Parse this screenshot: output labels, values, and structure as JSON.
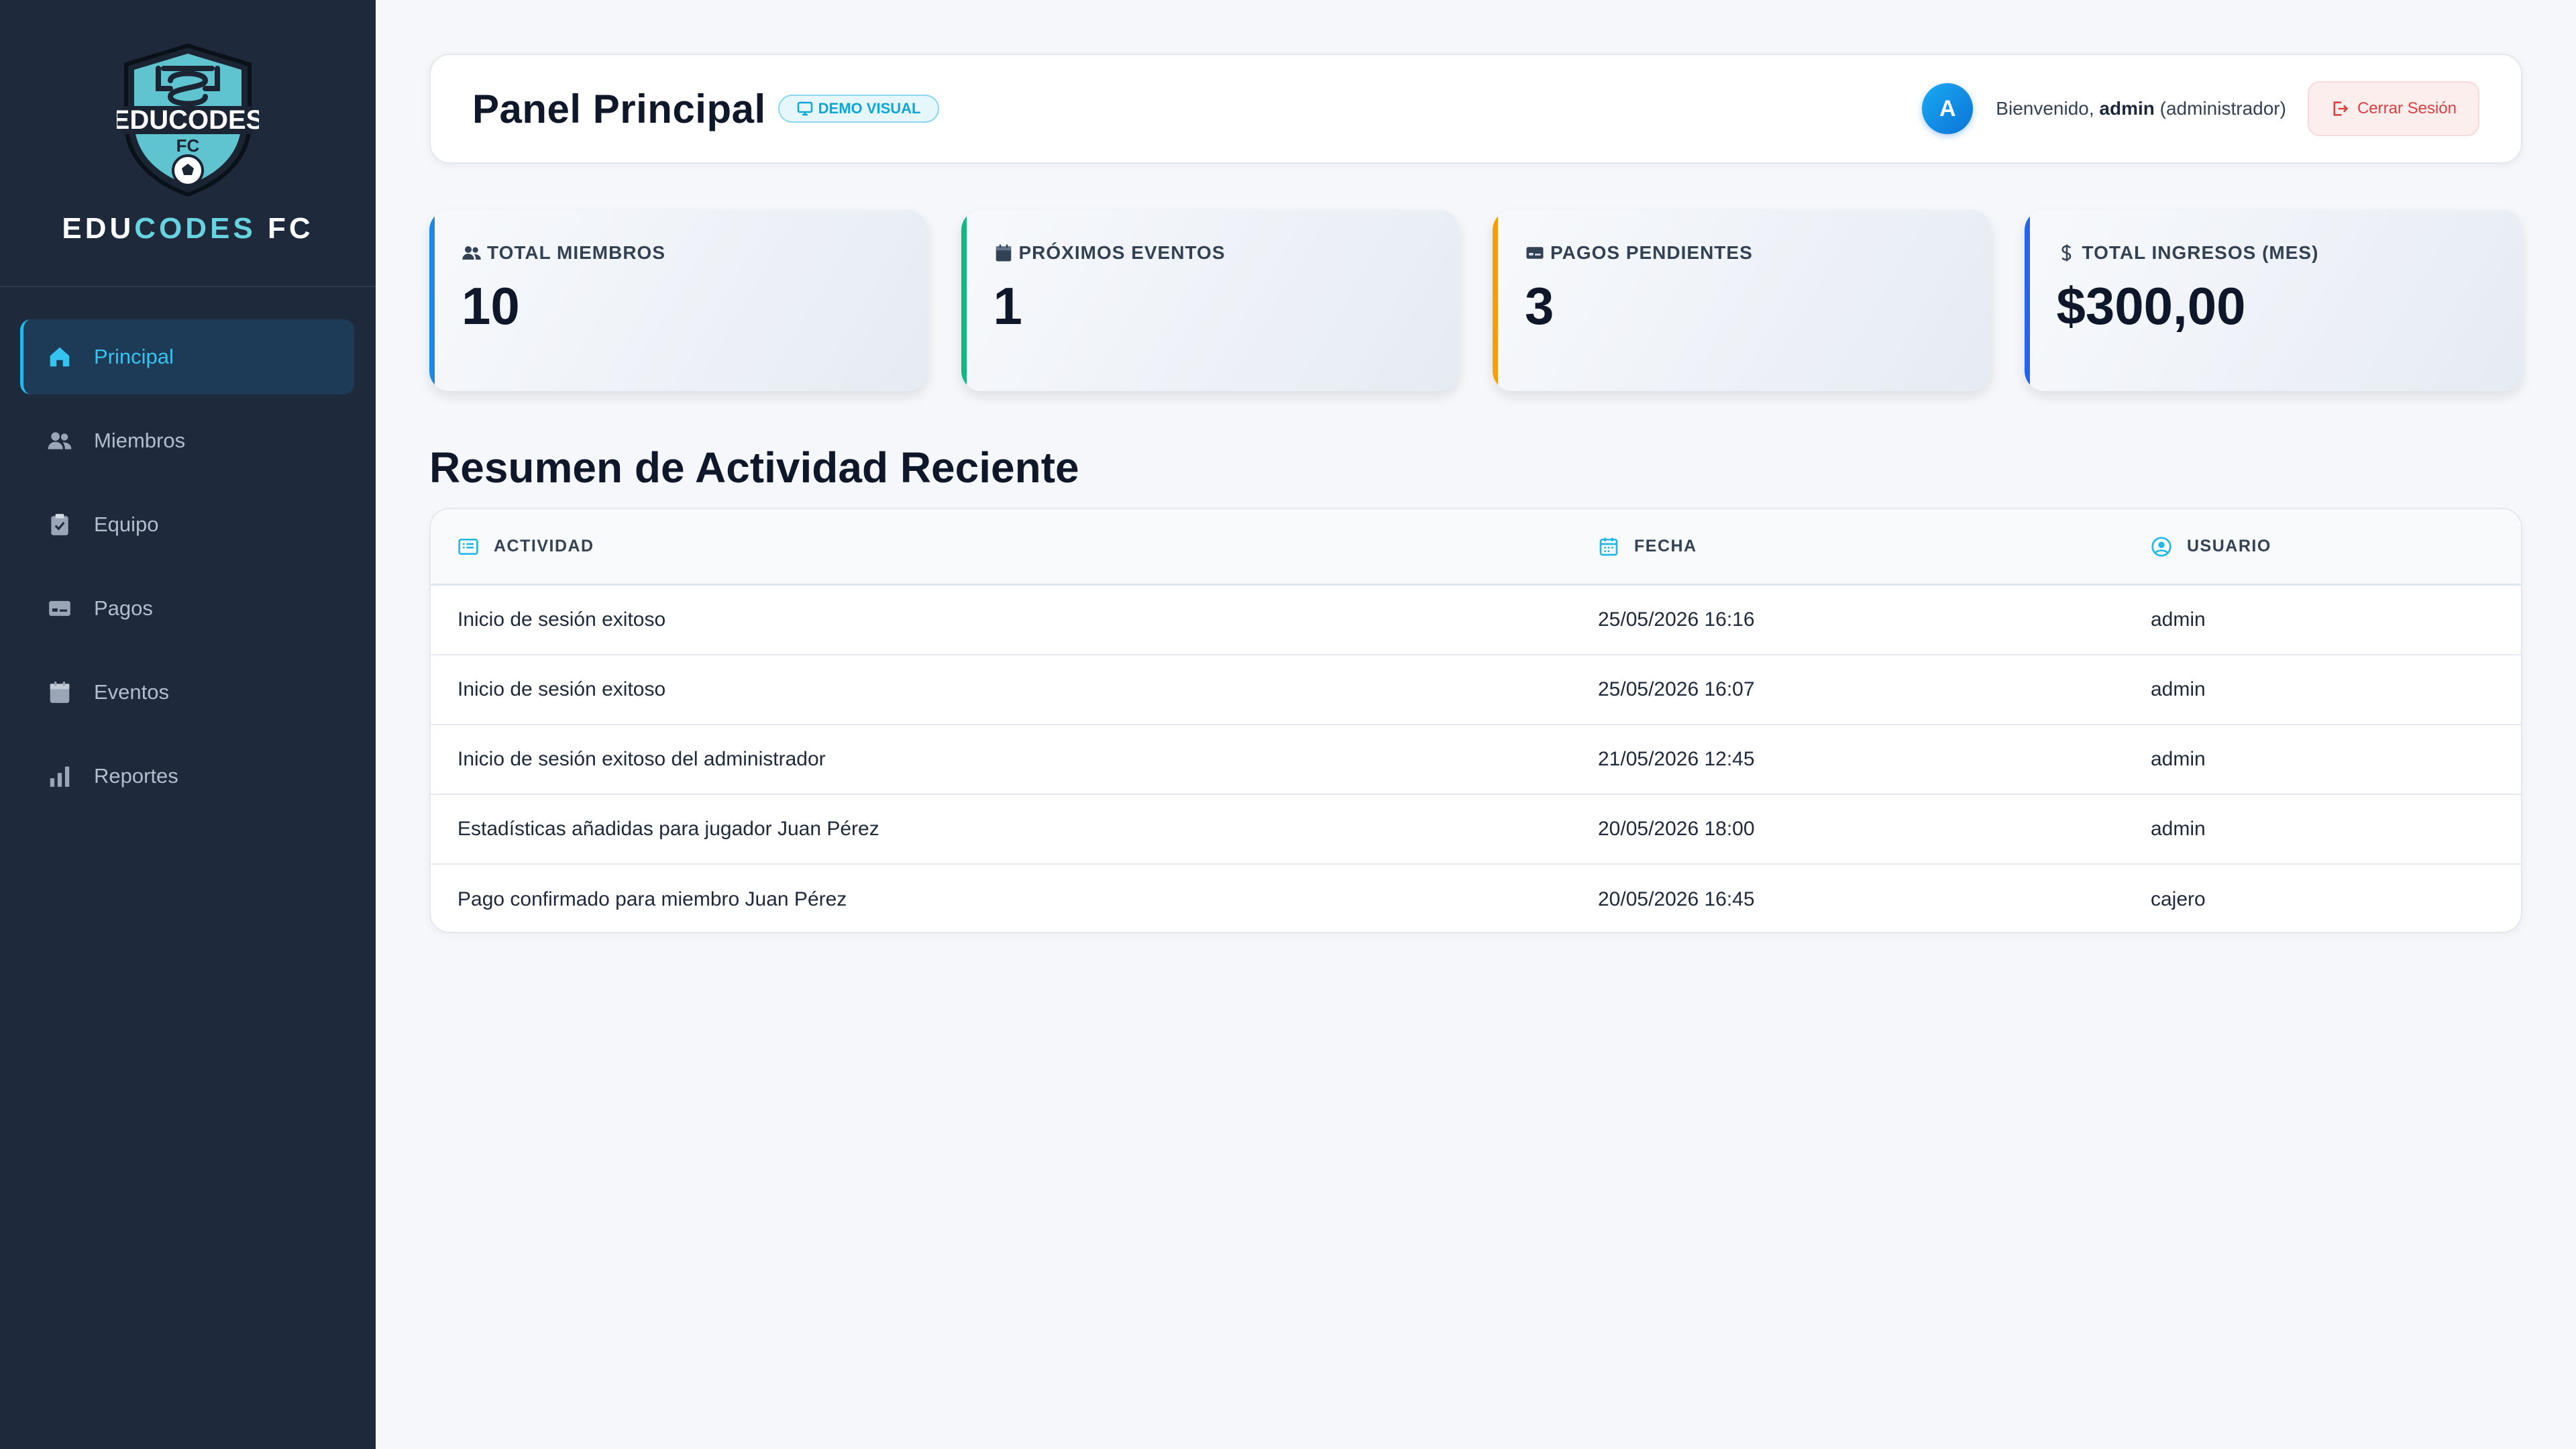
{
  "brand": {
    "logo_text": "EDUCODES",
    "logo_sub": "FC",
    "name_primary": "EDU",
    "name_accent": "CODES",
    "name_suffix": " FC",
    "accent_color": "#67d3e0"
  },
  "sidebar": {
    "items": [
      {
        "label": "Principal",
        "icon": "home-icon",
        "active": true
      },
      {
        "label": "Miembros",
        "icon": "users-icon",
        "active": false
      },
      {
        "label": "Equipo",
        "icon": "clipboard-icon",
        "active": false
      },
      {
        "label": "Pagos",
        "icon": "money-icon",
        "active": false
      },
      {
        "label": "Eventos",
        "icon": "calendar-icon",
        "active": false
      },
      {
        "label": "Reportes",
        "icon": "bar-chart-icon",
        "active": false
      }
    ]
  },
  "header": {
    "title": "Panel Principal",
    "badge": "DEMO VISUAL",
    "avatar_initial": "A",
    "welcome_prefix": "Bienvenido, ",
    "username": "admin",
    "role": " (administrador)",
    "logout_label": "Cerrar Sesión"
  },
  "stats": [
    {
      "label": "TOTAL MIEMBROS",
      "value": "10",
      "icon": "users-icon",
      "color": "#1e88e5"
    },
    {
      "label": "PRÓXIMOS EVENTOS",
      "value": "1",
      "icon": "calendar-icon",
      "color": "#10b981"
    },
    {
      "label": "PAGOS PENDIENTES",
      "value": "3",
      "icon": "money-icon",
      "color": "#f59e0b"
    },
    {
      "label": "TOTAL INGRESOS (MES)",
      "value": "$300,00",
      "icon": "dollar-icon",
      "color": "#2563eb"
    }
  ],
  "activity": {
    "title": "Resumen de Actividad Reciente",
    "columns": [
      "ACTIVIDAD",
      "FECHA",
      "USUARIO"
    ],
    "rows": [
      {
        "activity": "Inicio de sesión exitoso",
        "date": "25/05/2026 16:16",
        "user": "admin"
      },
      {
        "activity": "Inicio de sesión exitoso",
        "date": "25/05/2026 16:07",
        "user": "admin"
      },
      {
        "activity": "Inicio de sesión exitoso del administrador",
        "date": "21/05/2026 12:45",
        "user": "admin"
      },
      {
        "activity": "Estadísticas añadidas para jugador Juan Pérez",
        "date": "20/05/2026 18:00",
        "user": "admin"
      },
      {
        "activity": "Pago confirmado para miembro Juan Pérez",
        "date": "20/05/2026 16:45",
        "user": "cajero"
      }
    ]
  }
}
